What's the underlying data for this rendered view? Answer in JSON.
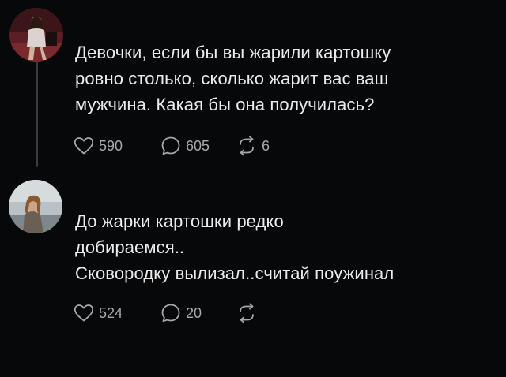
{
  "posts": [
    {
      "text": "Девочки, если бы вы жарили картошку\nровно столько, сколько жарит вас ваш\nмужчина. Какая бы она получилась?",
      "likes": "590",
      "replies": "605",
      "reposts": "6"
    },
    {
      "text": "До жарки картошки редко\nдобираемся..\nСковородку вылизал..считай поужинал",
      "likes": "524",
      "replies": "20",
      "reposts": ""
    }
  ],
  "icons": {
    "like": "heart-icon",
    "reply": "speech-bubble-icon",
    "repost": "repost-arrows-icon"
  },
  "colors": {
    "background": "#070809",
    "text": "#ebebeb",
    "muted": "#a8a8a8",
    "thread_line": "#3a3b3d"
  }
}
